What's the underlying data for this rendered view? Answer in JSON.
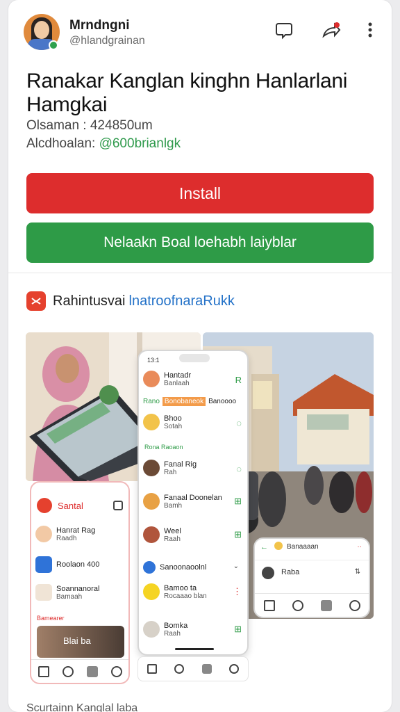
{
  "header": {
    "user_name": "Mrndngni",
    "user_handle": "@hlandgrainan",
    "icons": [
      "comment-icon",
      "share-icon",
      "more-vertical-icon"
    ]
  },
  "app": {
    "title": "Ranakar Kanglan kinghn Hanlarlani Hamgkai",
    "meta_line1": "Olsaman : 424850um",
    "meta_line2_label": "Alcdhoalan: ",
    "meta_line2_link": "@600brianlgk"
  },
  "buttons": {
    "install": "Install",
    "secondary": "Nelaakn Boal loehabh laiyblar"
  },
  "section": {
    "label": "Rahintusvai",
    "link": "lnatroofnaraRukk"
  },
  "phone_left": {
    "title": "Santal",
    "rows": [
      {
        "title": "Hanrat Rag",
        "sub": "Raadh"
      },
      {
        "title": "Roolaon 400",
        "sub": ""
      },
      {
        "title": "Soannanoral",
        "sub": "Bamaah"
      }
    ],
    "section": "Bamearer",
    "photo_label": "Blai ba"
  },
  "phone_mid": {
    "status": "13:1",
    "rows": [
      {
        "title": "Hantadr",
        "sub": "Banlaah"
      },
      {
        "title": "Bhoo",
        "sub": "Sotah"
      },
      {
        "title": "Fanal Rig",
        "sub": "Rah"
      },
      {
        "title": "Fanaal Doonelan",
        "sub": "Bamh"
      },
      {
        "title": "Weel",
        "sub": "Raah"
      },
      {
        "title": "Bamoo ta",
        "sub": "Rocaaao blan"
      },
      {
        "title": "Bomka",
        "sub": "Raah"
      }
    ],
    "tag_row": {
      "left": "Rano",
      "tag": "Bonobaneok",
      "right": "Banoooo"
    },
    "section2": "Rona Raoaon",
    "select_label": "Sanoonaoolnl"
  },
  "phone_right": {
    "row1": "Banaaaan",
    "row2": "Raba"
  },
  "bottom_peek": "Scurtainn Kanglal laba",
  "colors": {
    "install": "#dd2d2d",
    "secondary": "#2e9b47",
    "link_blue": "#2472c8",
    "link_green": "#2f9a4c"
  }
}
